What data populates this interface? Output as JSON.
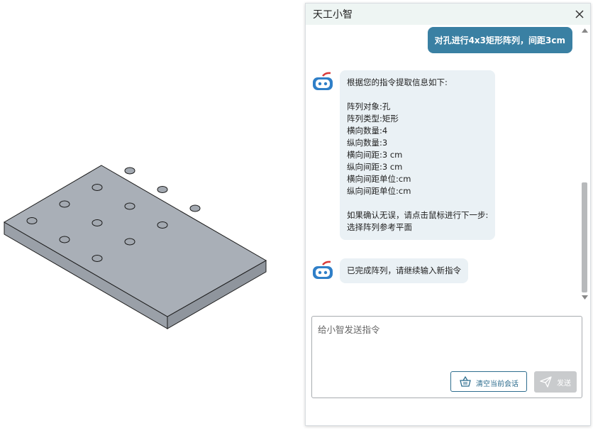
{
  "chat": {
    "title": "天工小智",
    "close_icon": "close-icon",
    "messages": [
      {
        "role": "user",
        "text": "对孔进行4x3矩形阵列，间距3cm"
      },
      {
        "role": "bot",
        "lines": [
          "根据您的指令提取信息如下:",
          "",
          "阵列对象:孔",
          "阵列类型:矩形",
          "横向数量:4",
          "纵向数量:3",
          "横向间距:3 cm",
          "纵向间距:3 cm",
          "横向间距单位:cm",
          "纵向间距单位:cm",
          "",
          "如果确认无误，请点击鼠标进行下一步:",
          "选择阵列参考平面"
        ]
      },
      {
        "role": "bot",
        "lines": [
          "已完成阵列，请继续输入新指令"
        ]
      }
    ],
    "input_placeholder": "给小智发送指令",
    "input_value": "",
    "clear_label": "清空当前会话",
    "send_label": "发送",
    "colors": {
      "accent": "#3a80a3",
      "bot_bubble": "#eaf1f5",
      "header": "#eef5f3",
      "send_disabled": "#c9cbcd"
    }
  },
  "model": {
    "plate_color": "#a7adb5",
    "edge_color": "#1a1a1a",
    "hole_grid": {
      "rows": 3,
      "cols": 4
    }
  }
}
